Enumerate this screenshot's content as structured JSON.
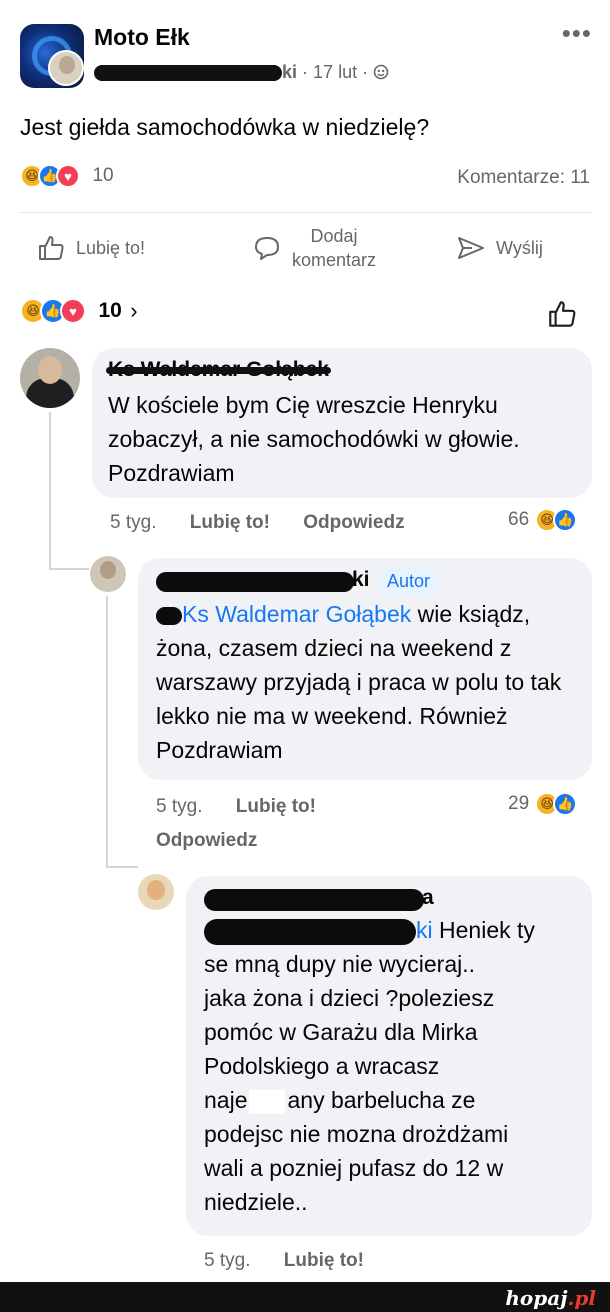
{
  "post": {
    "group_name": "Moto Ełk",
    "author_visible_fragment": "ki",
    "date": "17 lut",
    "separator": "·",
    "privacy_icon": "globe-icon",
    "text": "Jest giełda samochodówka w niedzielę?",
    "reaction_count": "10",
    "comments_label": "Komentarze: 11",
    "more_icon": "•••"
  },
  "actions": {
    "like": "Lubię to!",
    "comment_line1": "Dodaj",
    "comment_line2": "komentarz",
    "share": "Wyślij"
  },
  "summary": {
    "count": "10",
    "chevron": "›"
  },
  "comments": [
    {
      "author": "Ks Waldemar Gołąbek",
      "text": "W kościele bym Cię wreszcie Henryku zobaczył, a nie samochodówki w głowie. Pozdrawiam",
      "time": "5 tyg.",
      "like": "Lubię to!",
      "reply": "Odpowiedz",
      "reactions": "66"
    },
    {
      "author_visible_fragment": "ki",
      "badge": "Autor",
      "mention_visible_fragment": "Ks Waldemar Gołąbek",
      "text_after_mention": " wie ksiądz,",
      "text_rest": "żona, czasem dzieci na weekend z warszawy przyjadą i praca w polu to tak lekko nie ma w weekend. Również Pozdrawiam",
      "time": "5 tyg.",
      "like": "Lubię to!",
      "reply": "Odpowiedz",
      "reactions": "29"
    },
    {
      "author_visible_fragment": "a",
      "mention_visible_fragment": "ki",
      "text_after_mention": " Heniek ty",
      "text_rest_1": "se mną dupy nie wycieraj..",
      "text_rest_2": "jaka żona i dzieci ?poleziesz",
      "text_rest_3": "pomóc w Garażu dla Mirka",
      "text_rest_4": "Podolskiego a wracasz",
      "text_rest_5a": "naje",
      "text_rest_5b": "any barbelucha ze",
      "text_rest_6": "podejsc nie mozna drożdżami",
      "text_rest_7": "wali a pozniej pufasz do 12 w",
      "text_rest_8": "niedziele..",
      "time": "5 tyg.",
      "like": "Lubię to!"
    }
  ],
  "watermark": {
    "text": "hopaj",
    "suffix": ".pl"
  },
  "colors": {
    "link_blue": "#1877f2",
    "meta_gray": "#65676b",
    "bubble_bg": "#f0f2f5"
  }
}
